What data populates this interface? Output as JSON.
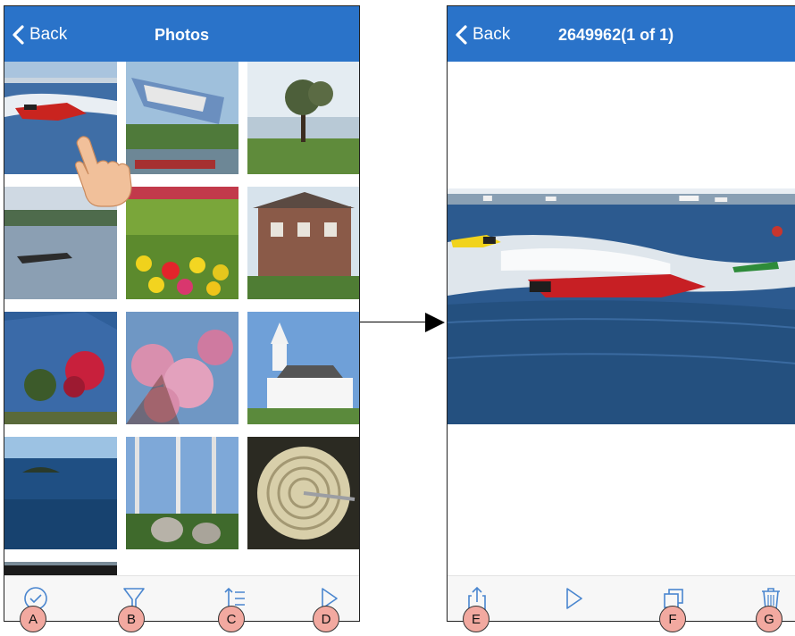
{
  "left_screen": {
    "back_label": "Back",
    "title": "Photos",
    "thumbnails": [
      {
        "subject": "speedboat"
      },
      {
        "subject": "boat-on-trailer"
      },
      {
        "subject": "tree-by-lake"
      },
      {
        "subject": "motorboat-on-water"
      },
      {
        "subject": "tulip-garden"
      },
      {
        "subject": "brick-house"
      },
      {
        "subject": "blue-house-flowers"
      },
      {
        "subject": "cherry-blossoms"
      },
      {
        "subject": "white-church"
      },
      {
        "subject": "island-in-sea"
      },
      {
        "subject": "birch-trees-rocks"
      },
      {
        "subject": "coiled-rope"
      }
    ],
    "toolbar": [
      "select-icon",
      "filter-icon",
      "sort-icon",
      "play-icon"
    ]
  },
  "right_screen": {
    "back_label": "Back",
    "title": "2649962(1 of 1)",
    "toolbar": [
      "share-icon",
      "play-icon",
      "copy-icon",
      "trash-icon"
    ]
  },
  "badges": [
    "A",
    "B",
    "C",
    "D",
    "E",
    "F",
    "G"
  ],
  "colors": {
    "navbar": "#2a73c9",
    "icon": "#4a86cf",
    "badge": "#f2a9a0"
  }
}
